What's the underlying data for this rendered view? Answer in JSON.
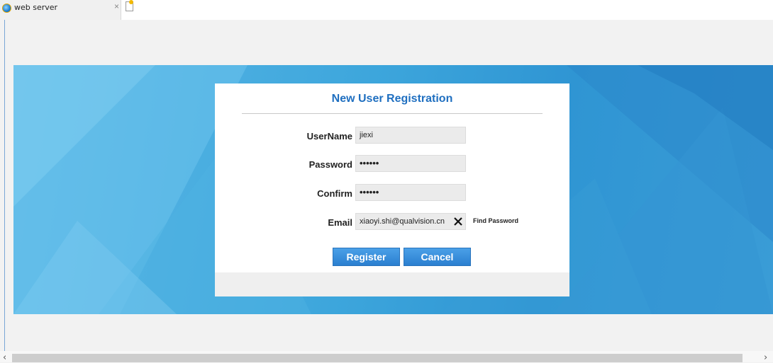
{
  "browser": {
    "tab_title": "web server",
    "tab_close": "×"
  },
  "form": {
    "title": "New User Registration",
    "fields": [
      {
        "label": "UserName",
        "value": "jiexi"
      },
      {
        "label": "Password",
        "value": "••••••"
      },
      {
        "label": "Confirm",
        "value": "••••••"
      },
      {
        "label": "Email",
        "value": "xiaoyi.shi@qualvision.cn"
      }
    ],
    "find_password_label": "Find Password",
    "register_label": "Register",
    "cancel_label": "Cancel"
  },
  "scrollbar": {
    "left_arrow": "‹",
    "right_arrow": "›"
  },
  "colors": {
    "banner_blue": "#3da6dc",
    "title_blue": "#1f6fc0",
    "button_blue": "#3a8fdc"
  },
  "icons": [
    "browser-page-icon",
    "tab-close-icon",
    "new-tab-icon",
    "clear-x-icon"
  ]
}
